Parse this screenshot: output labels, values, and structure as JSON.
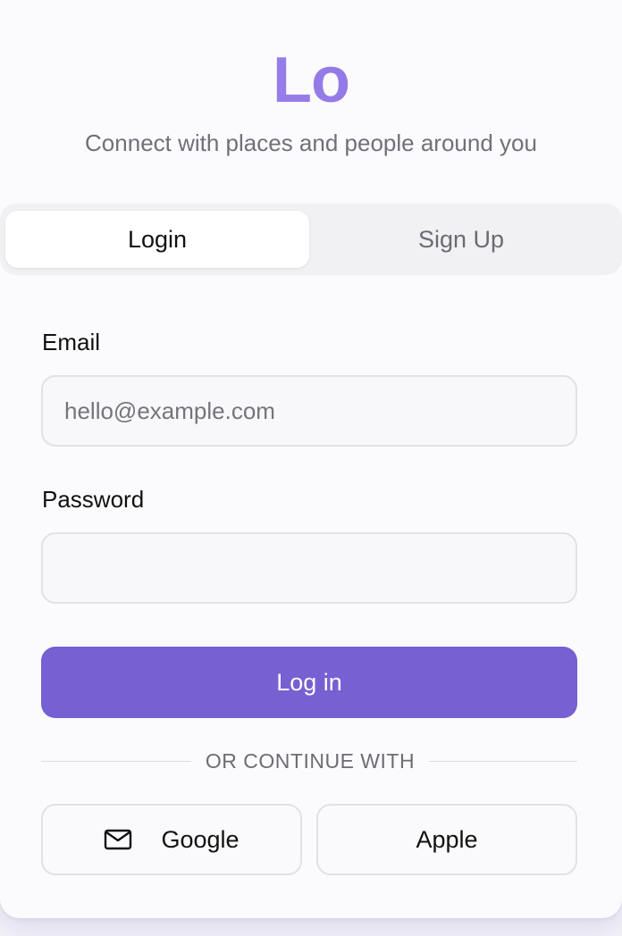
{
  "brand": {
    "logo": "Lo",
    "tagline": "Connect with places and people around you",
    "accent_color": "#7660d2"
  },
  "tabs": [
    {
      "label": "Login",
      "active": true
    },
    {
      "label": "Sign Up",
      "active": false
    }
  ],
  "form": {
    "email_label": "Email",
    "email_placeholder": "hello@example.com",
    "email_value": "",
    "password_label": "Password",
    "password_value": "",
    "submit_label": "Log in"
  },
  "divider": {
    "text": "OR CONTINUE WITH"
  },
  "social": [
    {
      "label": "Google",
      "icon": "mail-icon"
    },
    {
      "label": "Apple",
      "icon": ""
    }
  ]
}
